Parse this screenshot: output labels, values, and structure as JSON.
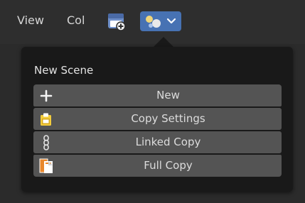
{
  "header": {
    "menus": {
      "view": "View",
      "col": "Col"
    },
    "toolbar": {
      "new_scene_icon": "new-scene-icon",
      "scene_icon": "scene-icon",
      "dropdown_icon": "chevron-down-icon"
    }
  },
  "popup": {
    "title": "New Scene",
    "options": [
      {
        "label": "New",
        "icon": "plus-icon"
      },
      {
        "label": "Copy Settings",
        "icon": "clipboard-icon"
      },
      {
        "label": "Linked Copy",
        "icon": "link-chain-icon"
      },
      {
        "label": "Full Copy",
        "icon": "duplicate-icon"
      }
    ]
  },
  "colors": {
    "background": "#2b2b2b",
    "header": "#2e2e2e",
    "popup_bg": "#191919",
    "option_bg": "#545454",
    "accent": "#4772b3",
    "text": "#dcdcdc"
  }
}
